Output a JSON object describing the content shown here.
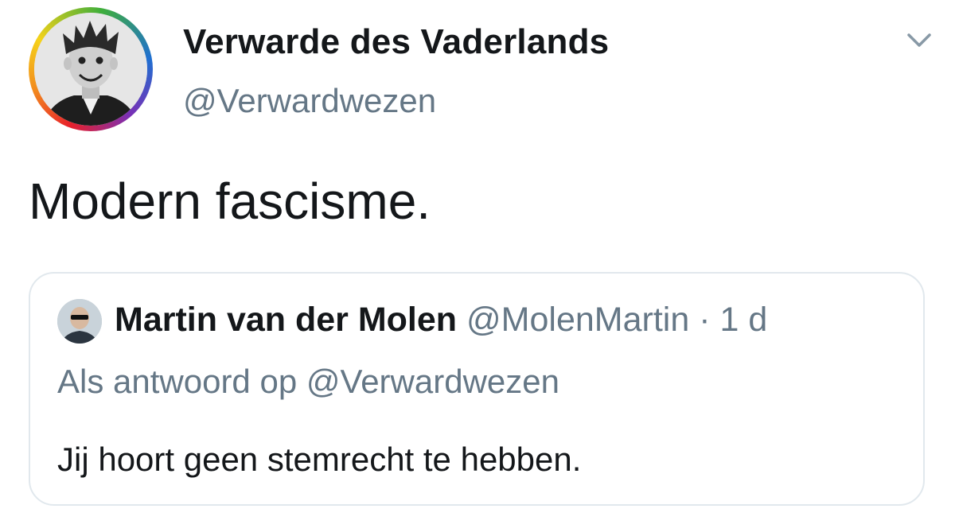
{
  "author": {
    "display_name": "Verwarde des Vaderlands",
    "handle": "@Verwardwezen",
    "avatar_icon": "author-avatar"
  },
  "menu": {
    "icon": "chevron-down-icon"
  },
  "tweet": {
    "text": "Modern fascisme."
  },
  "quoted_tweet": {
    "author_name": "Martin van der Molen",
    "author_handle": "@MolenMartin",
    "separator": "·",
    "time": "1 d",
    "reply_prefix": "Als antwoord op",
    "reply_to_handle": "@Verwardwezen",
    "text": "Jij hoort geen stemrecht te hebben."
  },
  "colors": {
    "primary_text": "#14171a",
    "secondary_text": "#657786",
    "border": "#e1e8ed",
    "background": "#ffffff"
  }
}
